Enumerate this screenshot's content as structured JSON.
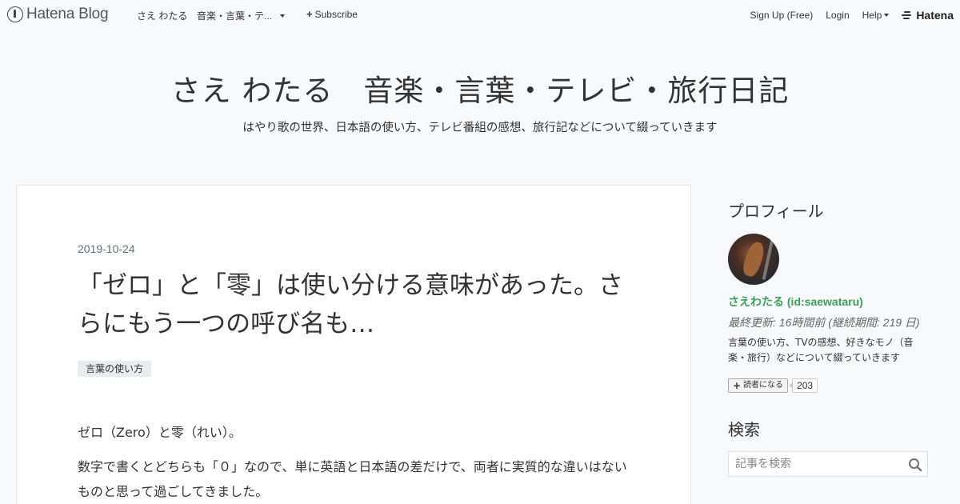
{
  "topbar": {
    "logo_text": "Hatena Blog",
    "blog_title_short": "さえ わたる",
    "blog_title_dropdown": "音楽・言葉・テ...",
    "subscribe_label": "Subscribe",
    "signup_label": "Sign Up (Free)",
    "login_label": "Login",
    "help_label": "Help",
    "brand_label": "Hatena"
  },
  "header": {
    "blog_name": "さえ わたる　音楽・言葉・テレビ・旅行日記",
    "description": "はやり歌の世界、日本語の使い方、テレビ番組の感想、旅行記などについて綴っていきます"
  },
  "article": {
    "date": "2019-10-24",
    "title": "「ゼロ」と「零」は使い分ける意味があった。さらにもう一つの呼び名も…",
    "category": "言葉の使い方",
    "body": [
      "ゼロ（Zero）と零（れい）。",
      "数字で書くとどちらも「０」なので、単に英語と日本語の差だけで、両者に実質的な違いはないものと思って過ごしてきました。"
    ]
  },
  "sidebar": {
    "profile": {
      "heading": "プロフィール",
      "name": "さえわたる (id:saewataru)",
      "updated": "最終更新: 16時間前 (継続期間: 219 日)",
      "description": "言葉の使い方、TVの感想、好きなモノ（音楽・旅行）などについて綴っていきます",
      "subscribe_label": "読者になる",
      "subscriber_count": "203"
    },
    "search": {
      "heading": "検索",
      "placeholder": "記事を検索"
    }
  },
  "colors": {
    "page_background": "#f8f9fa",
    "profile_name": "#3aa15a",
    "date_text": "#637079",
    "category_chip": "#e8ecef"
  },
  "icons": [
    "hatena-blog-logo-icon",
    "caret-down-icon",
    "plus-icon",
    "hatena-brand-icon",
    "search-icon"
  ]
}
